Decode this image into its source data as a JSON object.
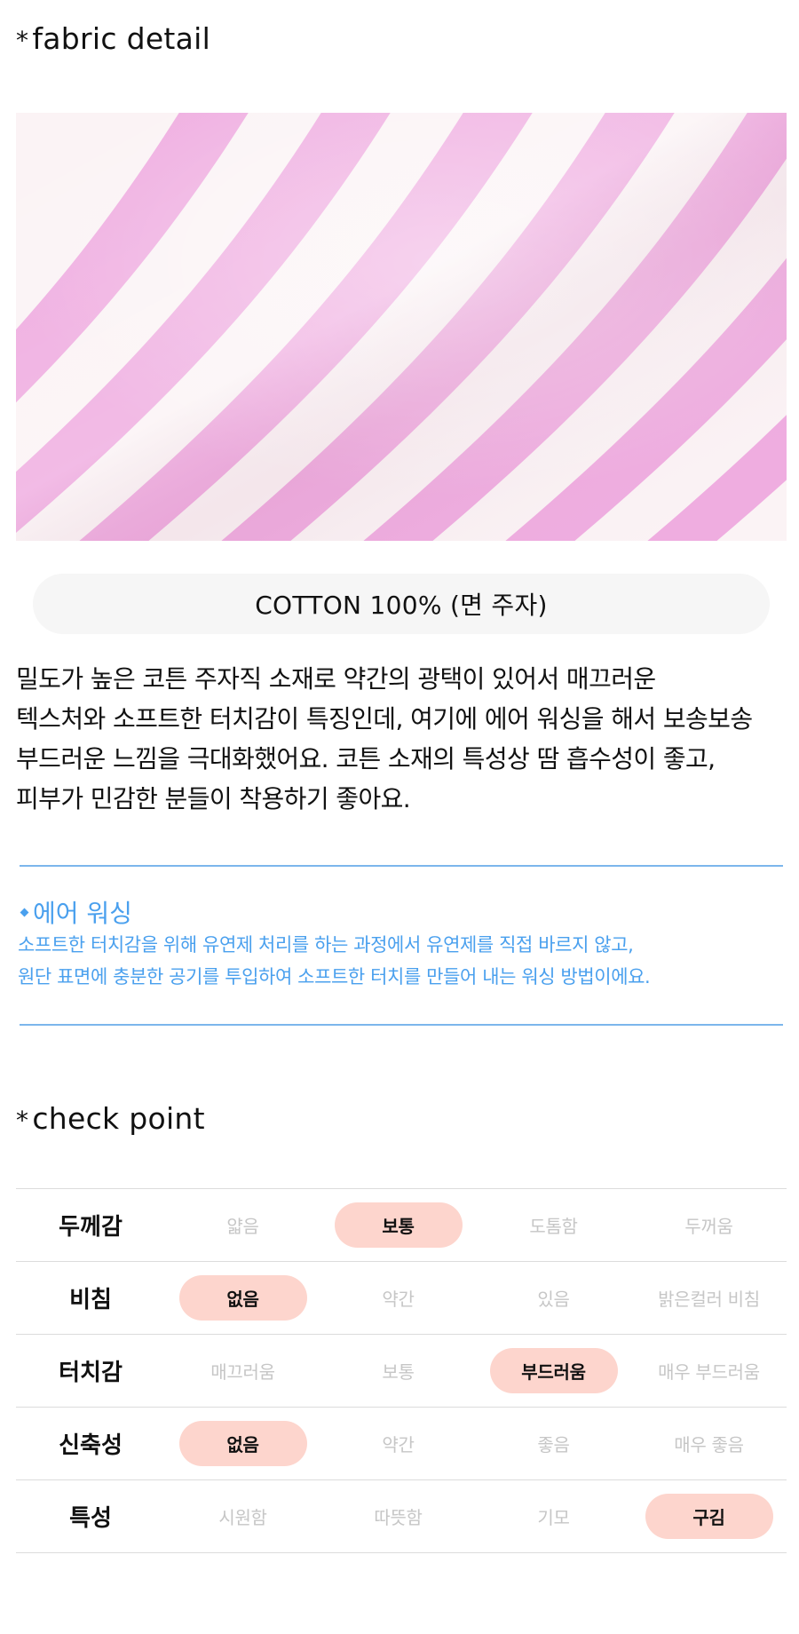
{
  "fabric_detail": {
    "heading_star": "*",
    "heading": "fabric detail",
    "material": "COTTON 100% (면 주자)",
    "description": "밀도가 높은 코튼 주자직 소재로 약간의 광택이 있어서 매끄러운\n텍스처와 소프트한 터치감이 특징인데, 여기에 에어 워싱을 해서 보송보송\n부드러운 느낌을 극대화했어요. 코튼 소재의 특성상 땀 흡수성이 좋고,\n피부가 민감한 분들이 착용하기 좋아요."
  },
  "note": {
    "title": "에어 워싱",
    "body": "소프트한 터치감을 위해 유연제 처리를 하는 과정에서 유연제를 직접 바르지 않고,\n원단 표면에 충분한 공기를 투입하여 소프트한 터치를 만들어 내는 워싱 방법이에요."
  },
  "check_point": {
    "heading_star": "*",
    "heading": "check point",
    "rows": [
      {
        "label": "두께감",
        "options": [
          "얇음",
          "보통",
          "도톰함",
          "두꺼움"
        ],
        "selected": 1
      },
      {
        "label": "비침",
        "options": [
          "없음",
          "약간",
          "있음",
          "밝은컬러 비침"
        ],
        "selected": 0
      },
      {
        "label": "터치감",
        "options": [
          "매끄러움",
          "보통",
          "부드러움",
          "매우 부드러움"
        ],
        "selected": 2
      },
      {
        "label": "신축성",
        "options": [
          "없음",
          "약간",
          "좋음",
          "매우 좋음"
        ],
        "selected": 0
      },
      {
        "label": "특성",
        "options": [
          "시원함",
          "따뜻함",
          "기모",
          "구김"
        ],
        "selected": 3
      }
    ]
  },
  "colors": {
    "accent_blue": "#4aa0ee",
    "divider_blue": "#7cb6ec",
    "selected_pill": "#fdd5cd",
    "unselected_text": "#c6c6c6",
    "stripe_pink": "#ec9fdc",
    "fabric_white": "#fbf3f5"
  }
}
